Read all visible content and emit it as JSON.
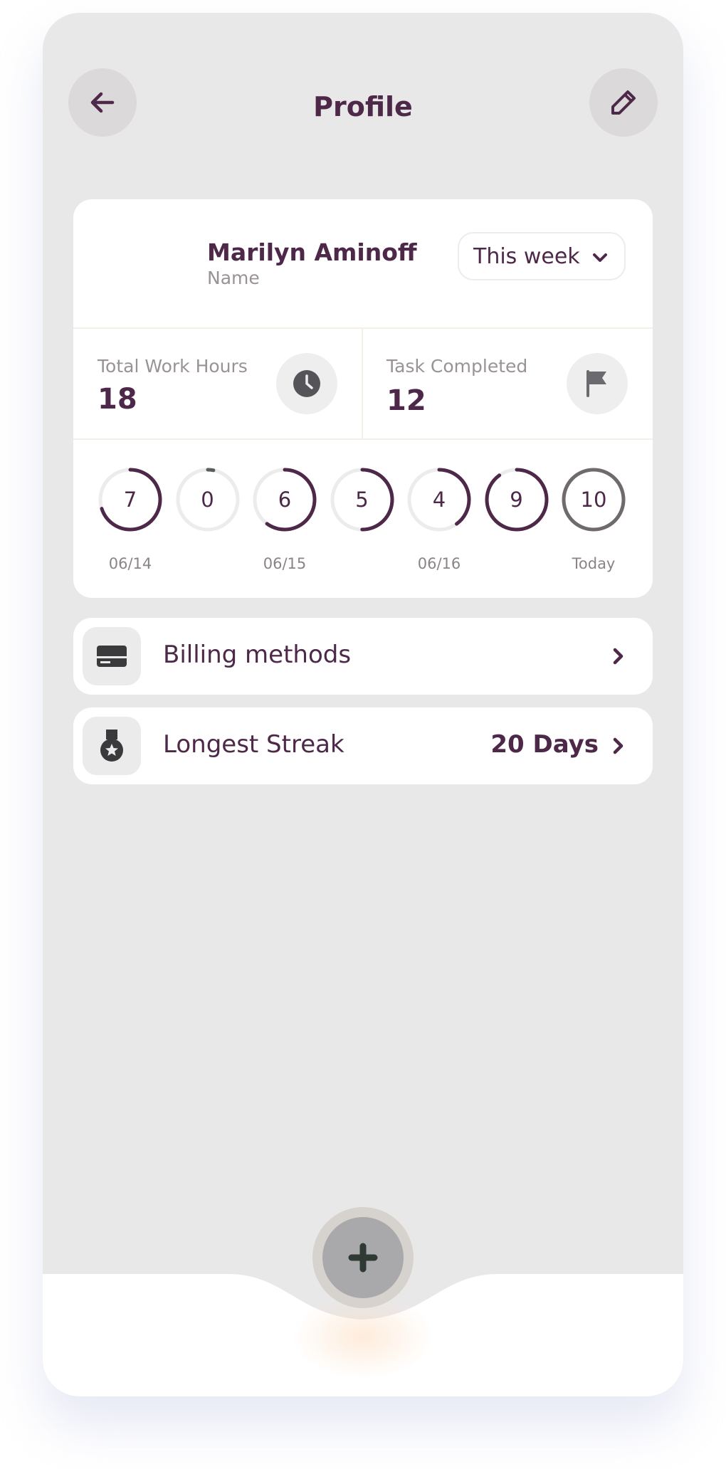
{
  "header": {
    "title": "Profile",
    "back_icon": "arrow-left-icon",
    "edit_icon": "pencil-icon"
  },
  "profile": {
    "name": "Marilyn Aminoff",
    "name_label": "Name",
    "period": "This week"
  },
  "stats": [
    {
      "label": "Total Work Hours",
      "value": "18",
      "icon": "clock-icon"
    },
    {
      "label": "Task Completed",
      "value": "12",
      "icon": "flag-icon"
    }
  ],
  "daily_hours": {
    "max": 10,
    "days": [
      {
        "value": 7
      },
      {
        "value": 0
      },
      {
        "value": 6
      },
      {
        "value": 5
      },
      {
        "value": 4
      },
      {
        "value": 9
      },
      {
        "value": 10,
        "today": true
      }
    ],
    "labels": [
      "06/14",
      "06/15",
      "06/16",
      "Today"
    ]
  },
  "menu": {
    "billing": {
      "label": "Billing methods",
      "icon": "credit-card-icon"
    },
    "streak": {
      "label": "Longest Streak",
      "value": "20 Days",
      "icon": "medal-icon"
    }
  },
  "fab": {
    "icon": "plus-icon"
  },
  "colors": {
    "primary": "#4e2849",
    "today_ring": "#6f6a6e",
    "ring_track": "#ececec",
    "background": "#e9e8e9"
  }
}
